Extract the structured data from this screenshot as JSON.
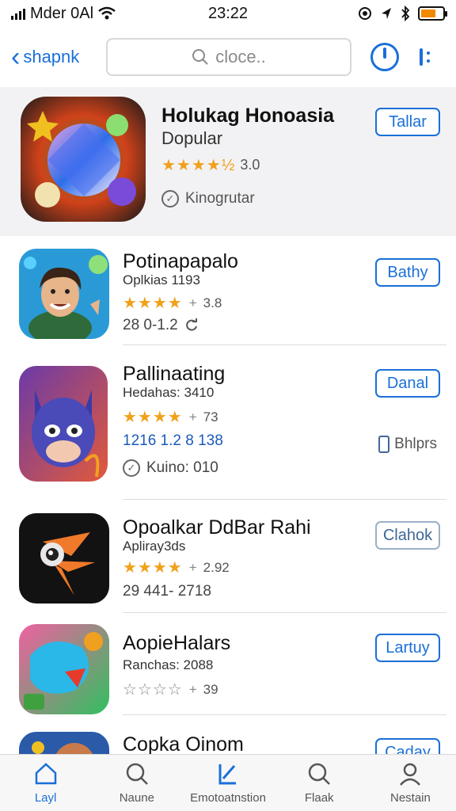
{
  "status_bar": {
    "carrier": "Mder 0Al",
    "time": "23:22"
  },
  "nav": {
    "back_label": "shapnk",
    "search_placeholder": "cloce.."
  },
  "featured": {
    "title": "Holukag Honoasia",
    "subtitle": "Dopular",
    "rating_text": "3.0",
    "meta": "Kinogrutar",
    "button": "Tallar"
  },
  "apps": [
    {
      "title": "Potinapapalo",
      "subtitle": "Oplkias 1193",
      "rating_text": "3.8",
      "meta": "28 0-1.2",
      "button": "Bathy",
      "stars_filled": 4
    },
    {
      "title": "Pallinaating",
      "subtitle": "Hedahas: 3410",
      "rating_text": "73",
      "meta": "1216 1.2  8 138",
      "meta2": "Kuino: 010",
      "side_link": "Bhlprs",
      "button": "Danal",
      "stars_filled": 4
    },
    {
      "title": "Opoalkar DdBar Rahi",
      "subtitle": "Apliray3ds",
      "rating_text": "2.92",
      "meta": "29 441- 2718",
      "button": "Clahok",
      "stars_filled": 4
    },
    {
      "title": "AopieHalars",
      "subtitle": "Ranchas: 2088",
      "rating_text": "39",
      "button": "Lartuy",
      "stars_filled": 0
    },
    {
      "title": "Copka Oinom",
      "button": "Caday"
    }
  ],
  "tabs": [
    {
      "label": "Layl",
      "icon": "home-icon",
      "active": true
    },
    {
      "label": "Naune",
      "icon": "search-icon"
    },
    {
      "label": "Emotoatnstion",
      "icon": "apps-icon"
    },
    {
      "label": "Flaak",
      "icon": "search-icon"
    },
    {
      "label": "Nestain",
      "icon": "profile-icon"
    }
  ],
  "colors": {
    "accent": "#1a6fd8",
    "star": "#f0a11b"
  }
}
